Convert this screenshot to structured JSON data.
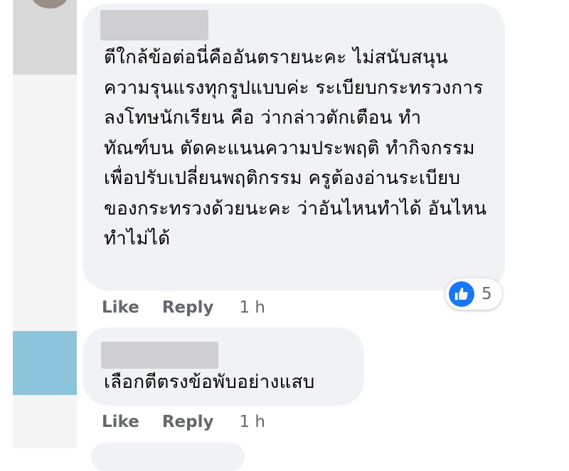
{
  "comments": [
    {
      "author": "",
      "text": "ตีใกล้ข้อต่อนี่คืออันตรายนะคะ ไม่สนับสนุนความรุนแรงทุกรูปแบบค่ะ ระเบียบกระทรวงการลงโทษนักเรียน คือ ว่ากล่าวตักเตือน ทำทัณฑ์บน ตัดคะแนนความประพฤติ ทำกิจกรรมเพื่อปรับเปลี่ยนพฤติกรรม ครูต้องอ่านระเบียบของกระทรวงด้วยนะคะ ว่าอันไหนทำได้ อันไหนทำไม่ได้",
      "like_label": "Like",
      "reply_label": "Reply",
      "time": "1 h",
      "reaction_icon": "like-icon",
      "reaction_count": "5"
    },
    {
      "author": "",
      "text": "เลือกตีตรงข้อพับอย่างแสบ",
      "like_label": "Like",
      "reply_label": "Reply",
      "time": "1 h"
    }
  ],
  "colors": {
    "bubble": "#f0f2f5",
    "action_text": "#65676b",
    "like_blue": "#1877f2"
  }
}
